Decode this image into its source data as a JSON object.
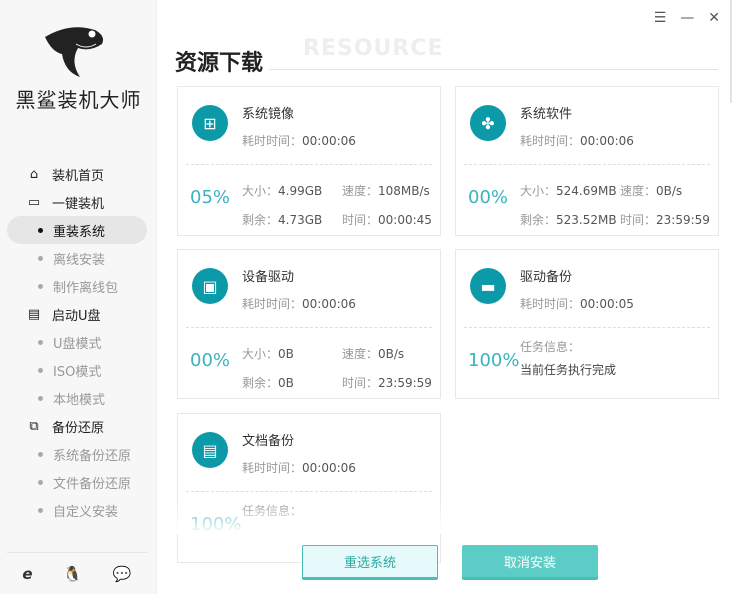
{
  "sidebar": {
    "brand": "黑鲨装机大师",
    "groups": [
      {
        "label": "装机首页",
        "icon": "home-icon",
        "items": []
      },
      {
        "label": "一键装机",
        "icon": "monitor-icon",
        "items": [
          "重装系统",
          "离线安装",
          "制作离线包"
        ]
      },
      {
        "label": "启动U盘",
        "icon": "usb-icon",
        "items": [
          "U盘模式",
          "ISO模式",
          "本地模式"
        ]
      },
      {
        "label": "备份还原",
        "icon": "backup-icon",
        "items": [
          "系统备份还原",
          "文件备份还原",
          "自定义安装"
        ]
      }
    ],
    "active": "重装系统",
    "footer_icons": [
      "ie-icon",
      "qq-icon",
      "wechat-icon"
    ]
  },
  "window": {
    "menu": "☰",
    "minimize": "—",
    "close": "✕"
  },
  "main": {
    "bg_word": "RESOURCE",
    "title": "资源下载",
    "cards": [
      {
        "name": "系统镜像",
        "icon": "windows-icon",
        "time_label": "耗时时间：",
        "time": "00:00:06",
        "pct": "05%",
        "size_l": "大小：",
        "size": "4.99GB",
        "speed_l": "速度：",
        "speed": "108MB/s",
        "remain_l": "剩余：",
        "remain": "4.73GB",
        "eta_l": "时间：",
        "eta": "00:00:45"
      },
      {
        "name": "系统软件",
        "icon": "software-icon",
        "time_label": "耗时时间：",
        "time": "00:00:06",
        "pct": "00%",
        "size_l": "大小：",
        "size": "524.69MB",
        "speed_l": "速度：",
        "speed": "0B/s",
        "remain_l": "剩余：",
        "remain": "523.52MB",
        "eta_l": "时间：",
        "eta": "23:59:59"
      },
      {
        "name": "设备驱动",
        "icon": "driver-icon",
        "time_label": "耗时时间：",
        "time": "00:00:06",
        "pct": "00%",
        "size_l": "大小：",
        "size": "0B",
        "speed_l": "速度：",
        "speed": "0B/s",
        "remain_l": "剩余：",
        "remain": "0B",
        "eta_l": "时间：",
        "eta": "23:59:59"
      },
      {
        "name": "驱动备份",
        "icon": "disk-icon",
        "time_label": "耗时时间：",
        "time": "00:00:05",
        "pct": "100%",
        "info_l": "任务信息：",
        "info": "当前任务执行完成"
      },
      {
        "name": "文档备份",
        "icon": "document-icon",
        "time_label": "耗时时间：",
        "time": "00:00:06",
        "pct": "100%",
        "info_l": "任务信息："
      }
    ],
    "buttons": {
      "reselect": "重选系统",
      "cancel": "取消安装"
    }
  },
  "colors": {
    "accent": "#0c9aa8",
    "percent": "#3ab3c0",
    "button": "#5ccdc6"
  }
}
